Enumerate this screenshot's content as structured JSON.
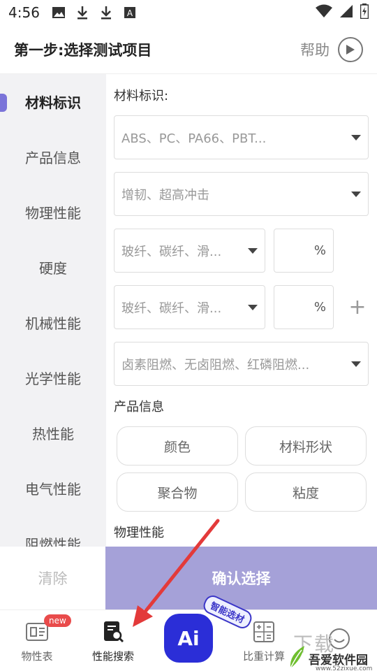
{
  "status": {
    "time": "4:56"
  },
  "header": {
    "title": "第一步:选择测试项目",
    "help": "帮助"
  },
  "sidebar": {
    "items": [
      {
        "label": "材料标识"
      },
      {
        "label": "产品信息"
      },
      {
        "label": "物理性能"
      },
      {
        "label": "硬度"
      },
      {
        "label": "机械性能"
      },
      {
        "label": "光学性能"
      },
      {
        "label": "热性能"
      },
      {
        "label": "电气性能"
      },
      {
        "label": "阻燃性能"
      }
    ]
  },
  "main": {
    "material_label": "材料标识:",
    "base_resin_placeholder": "ABS、PC、PA66、PBT...",
    "modifier_placeholder": "增韧、超高冲击",
    "filler1_placeholder": "玻纤、碳纤、滑...",
    "filler2_placeholder": "玻纤、碳纤、滑...",
    "percent": "%",
    "plus": "+",
    "flame_placeholder": "卤素阻燃、无卤阻燃、红磷阻燃...",
    "product_info_label": "产品信息",
    "chips": [
      "颜色",
      "材料形状",
      "聚合物",
      "粘度"
    ],
    "next_section_partial": "物理性能"
  },
  "actions": {
    "clear": "清除",
    "confirm": "确认选择"
  },
  "tabbar": {
    "tabs": [
      {
        "label": "物性表",
        "badge": "new"
      },
      {
        "label": "性能搜索"
      },
      {
        "label": "比重计算"
      }
    ],
    "ai_label": "Ai",
    "smart_tag": "智能选材"
  },
  "watermark": {
    "site": "吾爱软件园",
    "url": "www.52zixue.com",
    "big": "下载"
  },
  "colors": {
    "accent": "#7b74d9",
    "confirm_bg": "#a5a1d8",
    "ai_bg": "#2b2ed7",
    "arrow": "#e33a3a"
  }
}
